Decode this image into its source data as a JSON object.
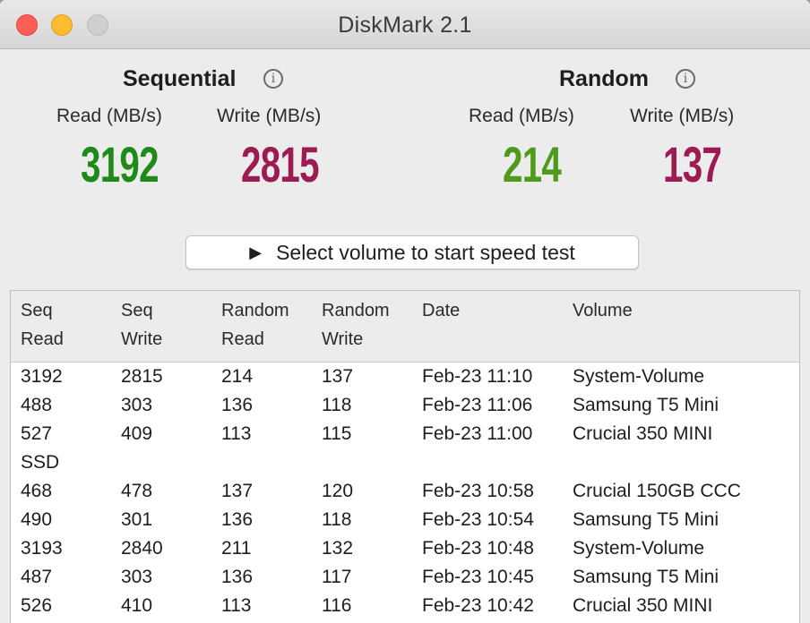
{
  "window": {
    "title": "DiskMark 2.1"
  },
  "sequential": {
    "title": "Sequential",
    "read_label": "Read (MB/s)",
    "write_label": "Write (MB/s)",
    "read_value": "3192",
    "write_value": "2815"
  },
  "random": {
    "title": "Random",
    "read_label": "Read (MB/s)",
    "write_label": "Write (MB/s)",
    "read_value": "214",
    "write_value": "137"
  },
  "start_button": {
    "label": "Select volume to start speed test"
  },
  "colors": {
    "seq_read": "#1f8a1a",
    "rand_read": "#4f9a1b",
    "write": "#9c1b52"
  },
  "table": {
    "headers": [
      {
        "line1": "Seq",
        "line2": "Read"
      },
      {
        "line1": "Seq",
        "line2": "Write"
      },
      {
        "line1": "Random",
        "line2": "Read"
      },
      {
        "line1": "Random",
        "line2": "Write"
      },
      {
        "line1": "Date",
        "line2": ""
      },
      {
        "line1": "Volume",
        "line2": ""
      }
    ],
    "rows": [
      [
        "3192",
        "2815",
        "214",
        "137",
        "Feb-23 11:10",
        "System-Volume"
      ],
      [
        "488",
        "303",
        "136",
        "118",
        "Feb-23 11:06",
        "Samsung T5 Mini"
      ],
      [
        "527",
        "409",
        "113",
        "115",
        "Feb-23 11:00",
        "Crucial 350 MINI"
      ],
      [
        "SSD",
        "",
        "",
        "",
        "",
        ""
      ],
      [
        "468",
        "478",
        "137",
        "120",
        "Feb-23 10:58",
        "Crucial 150GB CCC"
      ],
      [
        "490",
        "301",
        "136",
        "118",
        "Feb-23 10:54",
        "Samsung T5 Mini"
      ],
      [
        "3193",
        "2840",
        "211",
        "132",
        "Feb-23 10:48",
        "System-Volume"
      ],
      [
        "487",
        "303",
        "136",
        "117",
        "Feb-23 10:45",
        "Samsung T5 Mini"
      ],
      [
        "526",
        "410",
        "113",
        "116",
        "Feb-23 10:42",
        "Crucial 350 MINI"
      ]
    ]
  }
}
